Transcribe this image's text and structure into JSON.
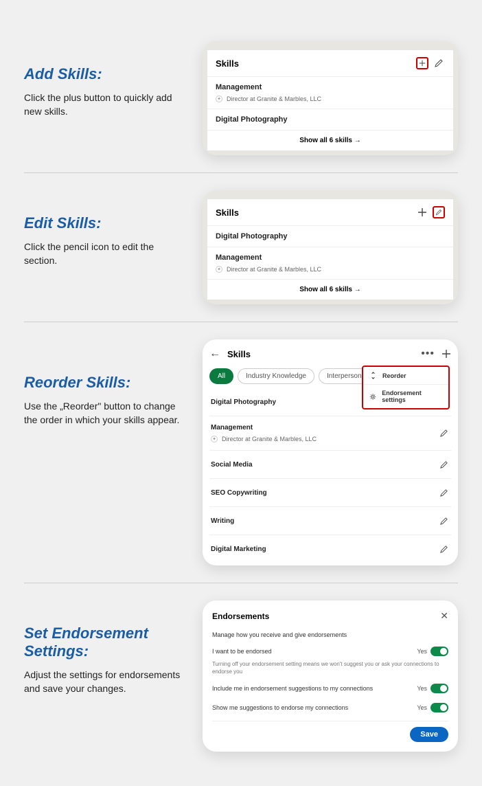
{
  "sections": [
    {
      "heading": "Add Skills:",
      "body": "Click the plus button to quickly add new skills.",
      "card": {
        "title": "Skills",
        "skills": [
          {
            "name": "Management",
            "sub": "Director at Granite & Marbles, LLC"
          },
          {
            "name": "Digital Photography"
          }
        ],
        "show_all": "Show all 6 skills →"
      }
    },
    {
      "heading": "Edit Skills:",
      "body": "Click the pencil icon to edit the section.",
      "card": {
        "title": "Skills",
        "skills": [
          {
            "name": "Digital Photography"
          },
          {
            "name": "Management",
            "sub": "Director at Granite & Marbles, LLC"
          }
        ],
        "show_all": "Show all 6 skills →"
      }
    },
    {
      "heading": "Reorder Skills:",
      "body": "Use the „Reorder\" button to change the order in which your skills appear.",
      "card": {
        "title": "Skills",
        "pills": [
          "All",
          "Industry Knowledge",
          "Interpersonal Skills"
        ],
        "menu": [
          "Reorder",
          "Endorsement settings"
        ],
        "skills": [
          {
            "name": "Digital Photography"
          },
          {
            "name": "Management",
            "sub": "Director at Granite & Marbles, LLC"
          },
          {
            "name": "Social Media"
          },
          {
            "name": "SEO Copywriting"
          },
          {
            "name": "Writing"
          },
          {
            "name": "Digital Marketing"
          }
        ]
      }
    },
    {
      "heading": "Set Endorsement Settings:",
      "body": "Adjust the settings for endorsements and save your changes.",
      "card": {
        "title": "Endorsements",
        "desc": "Manage how you receive and give endorsements",
        "rows": [
          {
            "label": "I want to be endorsed",
            "val": "Yes"
          }
        ],
        "help": "Turning off your endorsement setting means we won't suggest you or ask your connections to endorse you",
        "rows2": [
          {
            "label": "Include me in endorsement suggestions to my connections",
            "val": "Yes"
          },
          {
            "label": "Show me suggestions to endorse my connections",
            "val": "Yes"
          }
        ],
        "save": "Save"
      }
    }
  ]
}
